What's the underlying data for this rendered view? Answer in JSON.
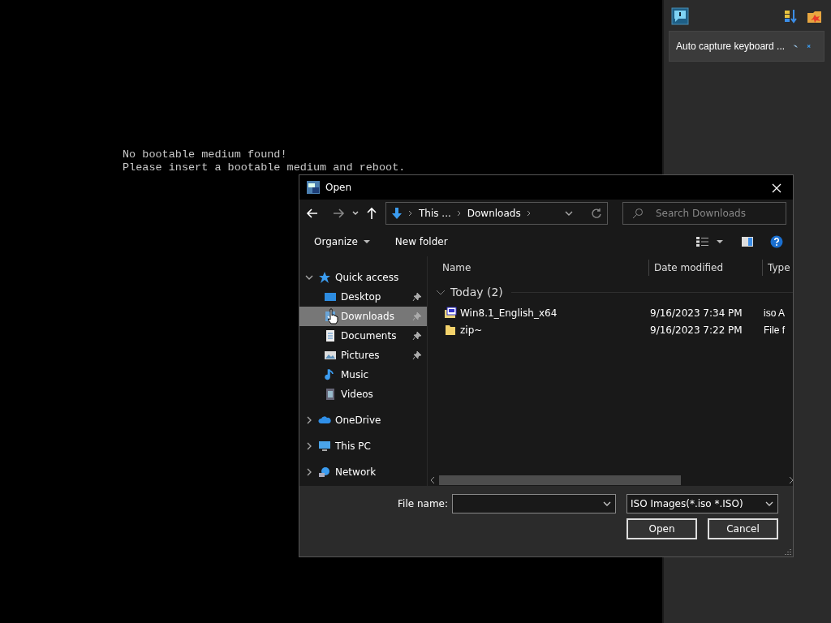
{
  "console": {
    "lines": [
      "No bootable medium found!",
      "Please insert a bootable medium and reboot."
    ]
  },
  "side_panel": {
    "notification": {
      "text": "Auto capture keyboard ..."
    }
  },
  "dialog": {
    "title": "Open",
    "breadcrumb": [
      "This ...",
      "Downloads"
    ],
    "search": {
      "placeholder": "Search Downloads"
    },
    "toolbar": [
      "Organize",
      "New folder"
    ],
    "nav": [
      {
        "label": "Quick access",
        "kind": "star",
        "expanded": true,
        "children": [
          {
            "label": "Desktop",
            "kind": "desktop",
            "pinned": true,
            "selected": false
          },
          {
            "label": "Downloads",
            "kind": "download",
            "pinned": true,
            "selected": true
          },
          {
            "label": "Documents",
            "kind": "document",
            "pinned": true,
            "selected": false
          },
          {
            "label": "Pictures",
            "kind": "pictures",
            "pinned": true,
            "selected": false
          },
          {
            "label": "Music",
            "kind": "music",
            "pinned": false,
            "selected": false
          },
          {
            "label": "Videos",
            "kind": "video",
            "pinned": false,
            "selected": false
          }
        ]
      },
      {
        "label": "OneDrive",
        "kind": "cloud",
        "expanded": false
      },
      {
        "label": "This PC",
        "kind": "computer",
        "expanded": false
      },
      {
        "label": "Network",
        "kind": "network",
        "expanded": false
      }
    ],
    "columns": [
      "Name",
      "Date modified",
      "Type"
    ],
    "group": {
      "label": "Today (2)",
      "expanded": true
    },
    "files": [
      {
        "name": "Win8.1_English_x64",
        "kind": "iso",
        "date": "9/16/2023 7:34 PM",
        "type": "iso A"
      },
      {
        "name": "zip~",
        "kind": "folder",
        "date": "9/16/2023 7:22 PM",
        "type": "File f"
      }
    ],
    "file_name_label": "File name:",
    "file_type": "ISO Images(*.iso *.ISO)",
    "buttons": [
      "Open",
      "Cancel"
    ]
  }
}
